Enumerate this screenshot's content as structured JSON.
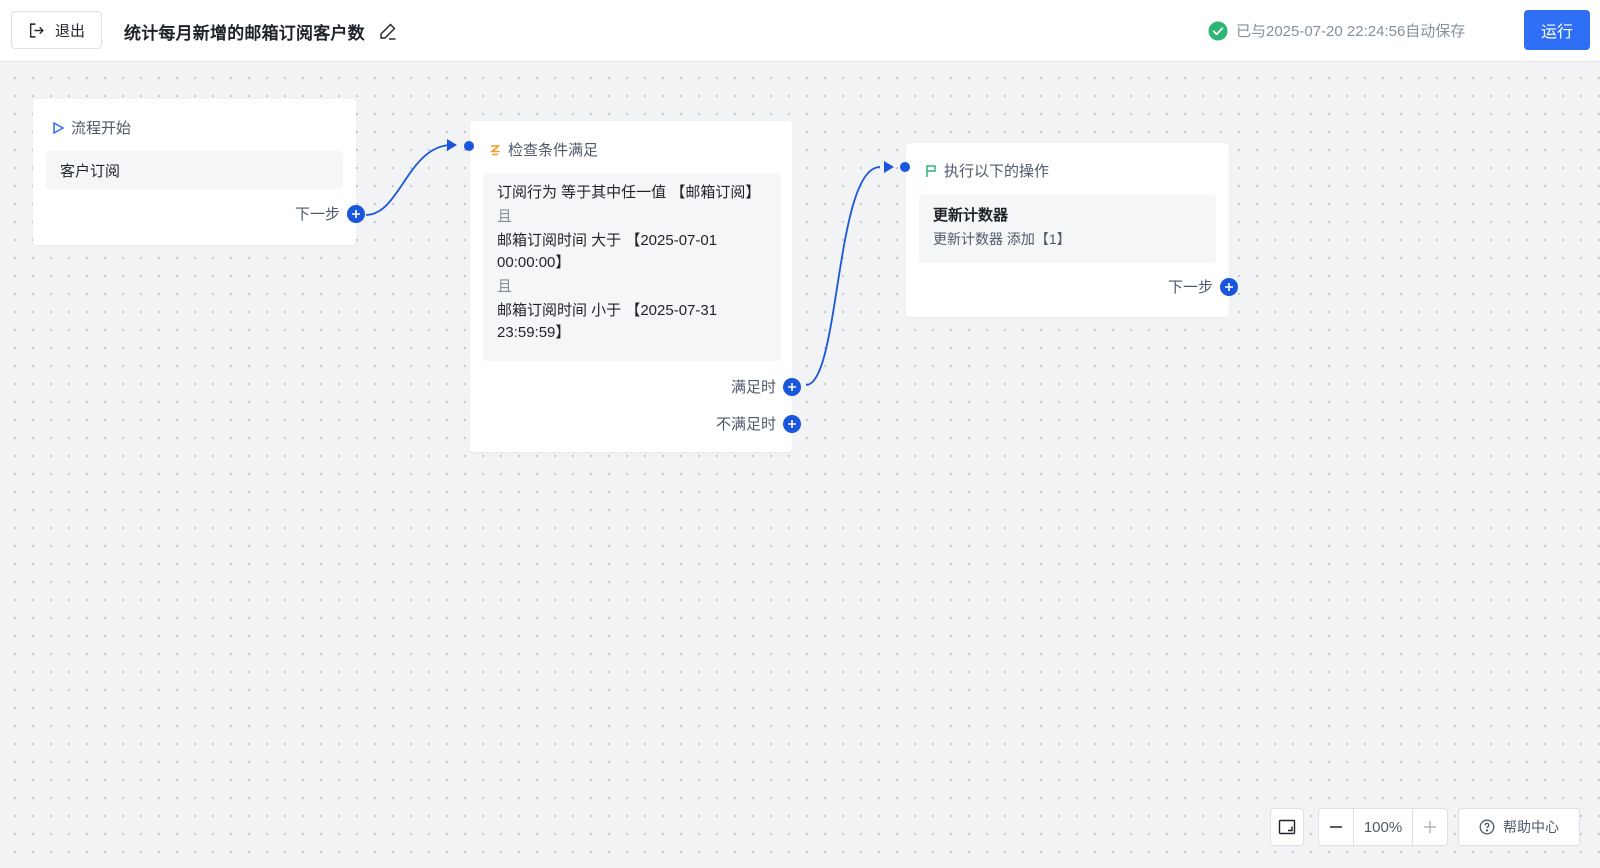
{
  "header": {
    "exit_label": "退出",
    "title": "统计每月新增的邮箱订阅客户数",
    "save_status": "已与2025-07-20 22:24:56自动保存",
    "run_label": "运行"
  },
  "nodes": {
    "start": {
      "title": "流程开始",
      "trigger": "客户订阅",
      "next_label": "下一步"
    },
    "condition": {
      "title": "检查条件满足",
      "line1": "订阅行为 等于其中任一值 【邮箱订阅】",
      "and1": "且",
      "line2": "邮箱订阅时间 大于 【2025-07-01 00:00:00】",
      "and2": "且",
      "line3": "邮箱订阅时间 小于 【2025-07-31 23:59:59】",
      "yes_label": "满足时",
      "no_label": "不满足时"
    },
    "action": {
      "title": "执行以下的操作",
      "action_name": "更新计数器",
      "action_detail": "更新计数器 添加【1】",
      "next_label": "下一步"
    }
  },
  "controls": {
    "zoom": "100%",
    "help_label": "帮助中心"
  },
  "colors": {
    "primary": "#2f6ff5",
    "port": "#1a56db",
    "success": "#2bb673",
    "condition_icon": "#f59a23",
    "action_icon": "#2bb673"
  },
  "icons": {
    "exit": "exit-icon",
    "edit": "edit-icon",
    "saved": "check-circle-icon",
    "start": "play-triangle-icon",
    "condition": "branch-icon",
    "action": "flag-icon",
    "fit": "fit-view-icon",
    "zoom_out": "minus-icon",
    "zoom_in": "plus-icon",
    "help": "help-circle-icon"
  }
}
